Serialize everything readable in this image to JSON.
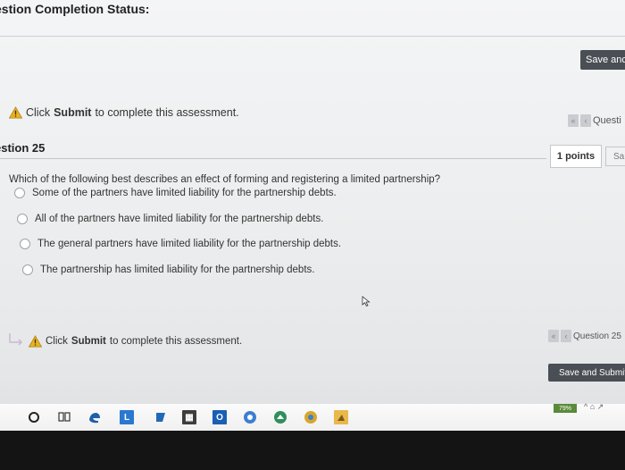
{
  "header": {
    "title": "estion Completion Status:",
    "save_button": "Save anc"
  },
  "notice_top": {
    "prefix": "Click",
    "bold": "Submit",
    "suffix": "to complete this assessment."
  },
  "question_nav_top": {
    "label": "Questi"
  },
  "question": {
    "heading": "estion 25",
    "points": "1 points",
    "save_short": "Sa",
    "text": "Which of the following best describes an effect of forming and registering a limited partnership?",
    "options": [
      "Some of the partners have limited liability for the partnership debts.",
      "All of the partners have limited liability for the partnership debts.",
      "The general partners have limited liability for the partnership debts.",
      "The partnership has limited liability for the partnership debts."
    ]
  },
  "notice_bottom": {
    "prefix": "Click",
    "bold": "Submit",
    "suffix": "to complete this assessment."
  },
  "question_nav_bottom": {
    "label": "Question 25"
  },
  "footer": {
    "save_submit": "Save and Submit"
  },
  "taskbar": {
    "icons": [
      "cortana-icon",
      "task-view-icon",
      "edge-icon",
      "store-icon",
      "gallery-icon",
      "calculator-icon",
      "outlook-icon",
      "chrome-icon",
      "maps-icon",
      "chrome-alt-icon",
      "folder-icon"
    ],
    "battery_label": "79%",
    "tray_glyphs": "^ ⌂ ↗"
  },
  "colors": {
    "dark_button": "#4a4f55",
    "warning": "#e8b321",
    "radio_border": "#9aa4ad"
  }
}
